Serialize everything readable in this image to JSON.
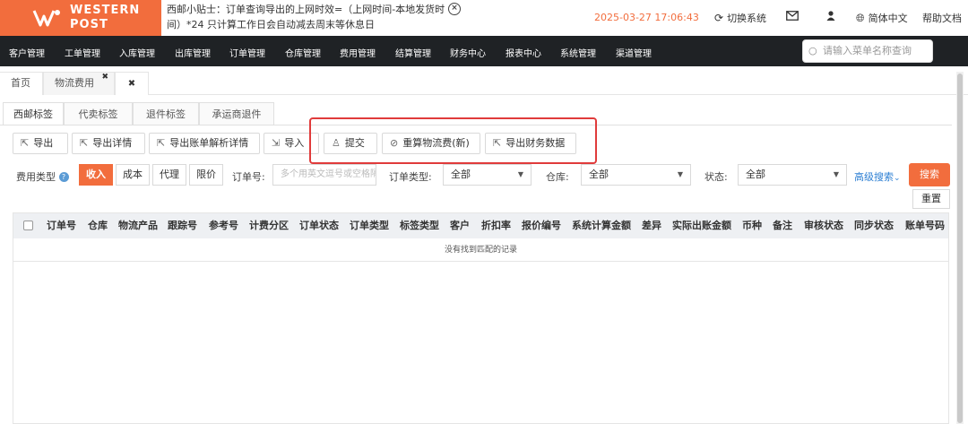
{
  "header": {
    "logo_text_1": "WESTERN",
    "logo_text_2": "POST",
    "notice_line1": "西邮小贴士：订单查询导出的上网时效=（上网时间-本地发货时",
    "notice_line2": "间）*24 只计算工作日会自动减去周末等休息日",
    "notice_close": "×",
    "datetime": "2025-03-27 17:06:43",
    "switch_system": "切换系统",
    "language": "简体中文",
    "help_docs": "帮助文档"
  },
  "nav": {
    "items": [
      "客户管理",
      "工单管理",
      "入库管理",
      "出库管理",
      "订单管理",
      "仓库管理",
      "费用管理",
      "结算管理",
      "财务中心",
      "报表中心",
      "系统管理",
      "渠道管理"
    ],
    "search_placeholder": "请输入菜单名称查询"
  },
  "page_tabs": {
    "home": "首页",
    "logistics_fee": "物流费用",
    "close": "✖",
    "close_all": "✖"
  },
  "sub_tabs": [
    "西邮标签",
    "代卖标签",
    "退件标签",
    "承运商退件"
  ],
  "toolbar": {
    "export": "导出",
    "export_detail": "导出详情",
    "export_bill_detail": "导出账单解析详情",
    "import": "导入",
    "submit": "提交",
    "recalc_fee": "重算物流费(新)",
    "export_finance": "导出财务数据"
  },
  "filters": {
    "fee_type_label": "费用类型",
    "fee_types": [
      "收入",
      "成本",
      "代理",
      "限价"
    ],
    "fee_type_selected": "收入",
    "order_no_label": "订单号:",
    "order_no_placeholder": "多个用英文逗号或空格隔开",
    "order_type_label": "订单类型:",
    "order_type_value": "全部",
    "warehouse_label": "仓库:",
    "warehouse_value": "全部",
    "status_label": "状态:",
    "status_value": "全部",
    "advanced_search": "高级搜索",
    "search_button": "搜索",
    "reset_button": "重置"
  },
  "table": {
    "columns": [
      "订单号",
      "仓库",
      "物流产品",
      "跟踪号",
      "参考号",
      "计费分区",
      "订单状态",
      "订单类型",
      "标签类型",
      "客户",
      "折扣率",
      "报价编号",
      "系统计算金额",
      "差异",
      "实际出账金额",
      "币种",
      "备注",
      "审核状态",
      "同步状态",
      "账单号码"
    ],
    "empty_text": "没有找到匹配的记录"
  },
  "colors": {
    "brand": "#f26d3d",
    "nav_bg": "#1f2225",
    "highlight": "#e03b3b",
    "link": "#2d7fd3"
  }
}
